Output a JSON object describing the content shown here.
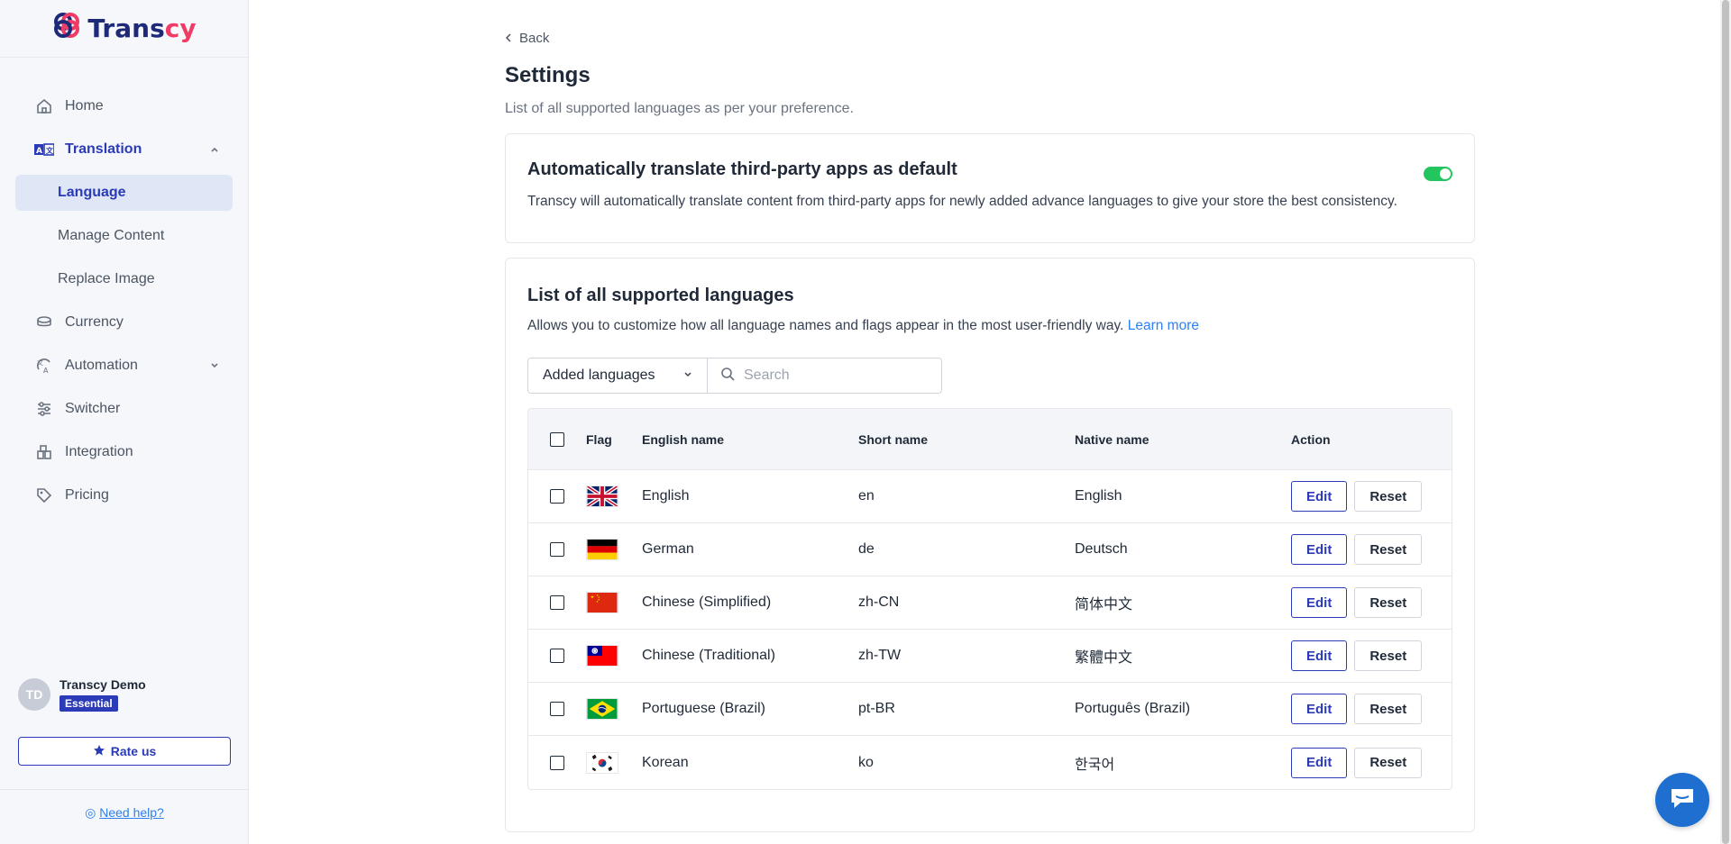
{
  "brand": {
    "name_main": "Trans",
    "name_accent": "cy"
  },
  "sidebar": {
    "items": [
      {
        "label": "Home",
        "icon": "home-icon"
      },
      {
        "label": "Translation",
        "icon": "translate-icon"
      },
      {
        "label": "Currency",
        "icon": "coins-icon"
      },
      {
        "label": "Automation",
        "icon": "automation-icon"
      },
      {
        "label": "Switcher",
        "icon": "sliders-icon"
      },
      {
        "label": "Integration",
        "icon": "integration-icon"
      },
      {
        "label": "Pricing",
        "icon": "tag-icon"
      }
    ],
    "sub_items": [
      "Language",
      "Manage Content",
      "Replace Image"
    ]
  },
  "user": {
    "initials": "TD",
    "name": "Transcy Demo",
    "plan": "Essential"
  },
  "rate_label": "Rate us",
  "help_label": "Need help?",
  "header": {
    "back": "Back",
    "title": "Settings",
    "subtitle": "List of all supported languages as per your preference."
  },
  "auto_card": {
    "title": "Automatically translate third-party apps as default",
    "description": "Transcy will automatically translate content from third-party apps for newly added advance languages to give your store the best consistency.",
    "enabled": true
  },
  "languages_card": {
    "title": "List of all supported languages",
    "description": "Allows you to customize how all language names and flags appear in the most user-friendly way.",
    "learn_more": "Learn more",
    "filter_value": "Added languages",
    "search_placeholder": "Search"
  },
  "table": {
    "headers": {
      "flag": "Flag",
      "english": "English name",
      "short": "Short name",
      "native": "Native name",
      "action": "Action"
    },
    "edit_label": "Edit",
    "reset_label": "Reset",
    "rows": [
      {
        "english": "English",
        "short": "en",
        "native": "English",
        "flag": "uk"
      },
      {
        "english": "German",
        "short": "de",
        "native": "Deutsch",
        "flag": "de"
      },
      {
        "english": "Chinese (Simplified)",
        "short": "zh-CN",
        "native": "简体中文",
        "flag": "cn"
      },
      {
        "english": "Chinese (Traditional)",
        "short": "zh-TW",
        "native": "繁體中文",
        "flag": "tw"
      },
      {
        "english": "Portuguese (Brazil)",
        "short": "pt-BR",
        "native": "Português (Brazil)",
        "flag": "br"
      },
      {
        "english": "Korean",
        "short": "ko",
        "native": "한국어",
        "flag": "kr"
      }
    ]
  },
  "colors": {
    "accent": "#2b3bb8",
    "brand_pink": "#ef3b66",
    "toggle_on": "#22c55e",
    "link": "#2f80ed"
  }
}
